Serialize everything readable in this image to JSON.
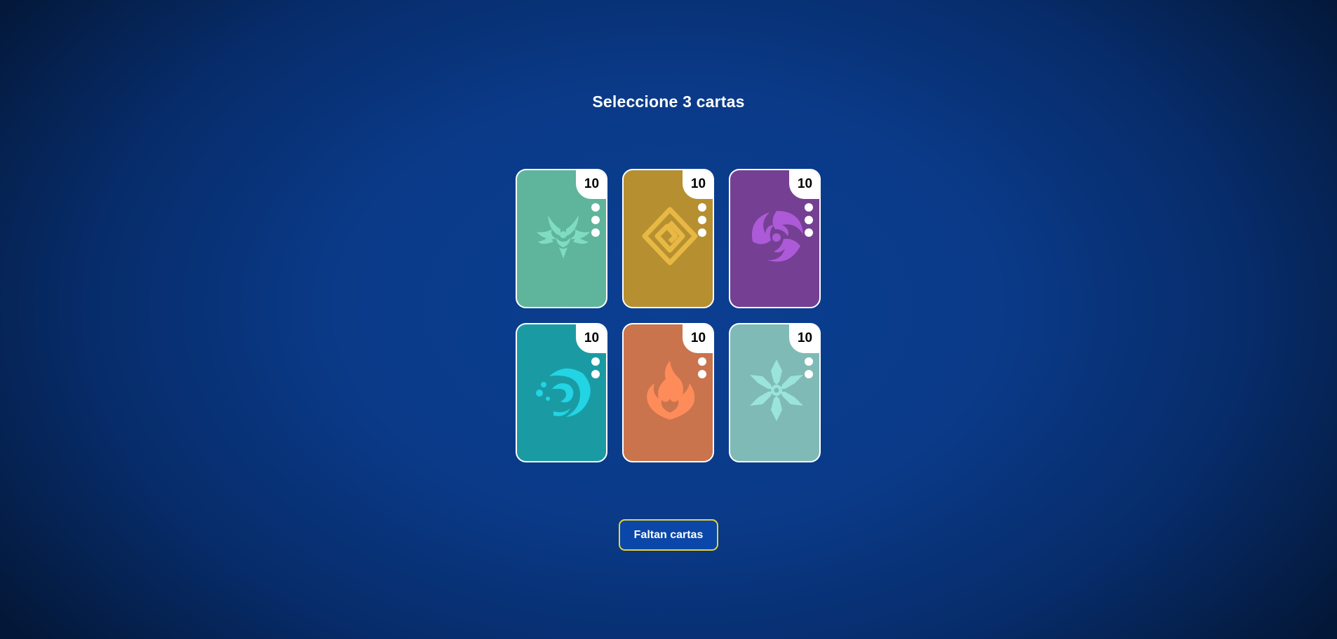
{
  "title": "Seleccione 3 cartas",
  "cards": [
    {
      "count": "10",
      "dots": 3,
      "bg": "#5fb49c",
      "emblem_color": "#7fdcc0",
      "icon": "anemo-icon"
    },
    {
      "count": "10",
      "dots": 3,
      "bg": "#b68f31",
      "emblem_color": "#e7b843",
      "icon": "geo-icon"
    },
    {
      "count": "10",
      "dots": 3,
      "bg": "#753f93",
      "emblem_color": "#ac5ad8",
      "icon": "electro-icon"
    },
    {
      "count": "10",
      "dots": 2,
      "bg": "#1a9ba4",
      "emblem_color": "#22d4e4",
      "icon": "hydro-icon"
    },
    {
      "count": "10",
      "dots": 2,
      "bg": "#c9744c",
      "emblem_color": "#fe8c5b",
      "icon": "pyro-icon"
    },
    {
      "count": "10",
      "dots": 2,
      "bg": "#80bab6",
      "emblem_color": "#9ae4dd",
      "icon": "cryo-icon"
    }
  ],
  "status_button": {
    "label": "Faltan cartas",
    "border_color": "#e9d23a"
  }
}
